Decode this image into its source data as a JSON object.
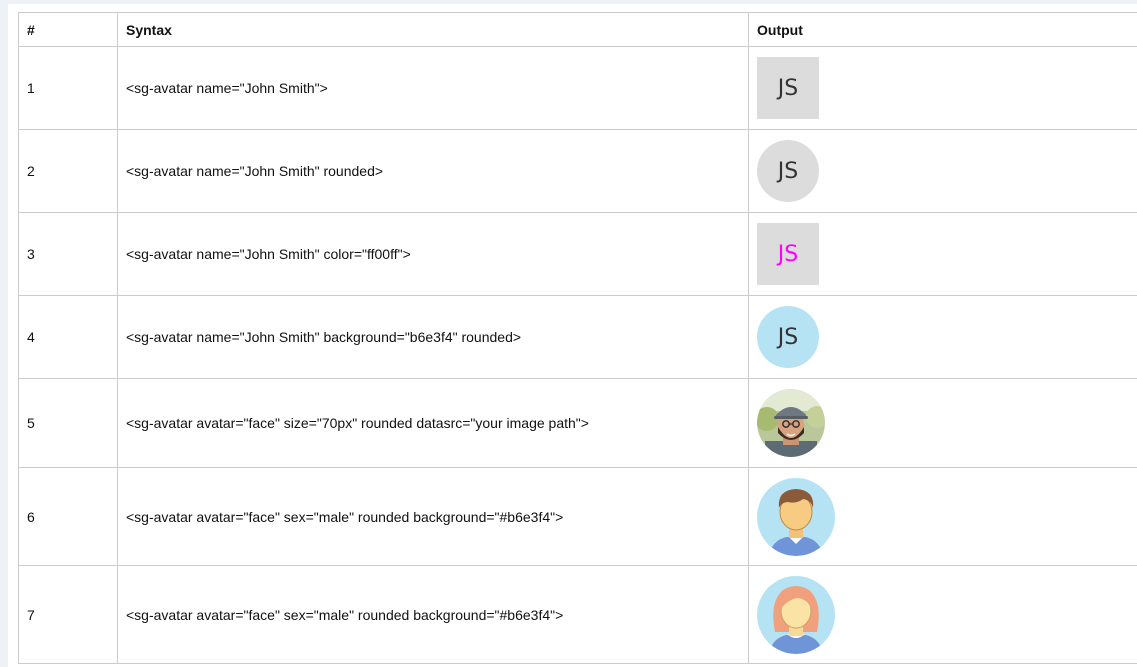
{
  "table": {
    "headers": {
      "num": "#",
      "syntax": "Syntax",
      "output": "Output"
    },
    "rows": [
      {
        "num": "1",
        "syntax": "<sg-avatar name=\"John Smith\">",
        "output": {
          "kind": "initials",
          "text": "JS",
          "shape": "square",
          "bg": "#dcdcdc",
          "color": "#333333"
        }
      },
      {
        "num": "2",
        "syntax": "<sg-avatar name=\"John Smith\" rounded>",
        "output": {
          "kind": "initials",
          "text": "JS",
          "shape": "round",
          "bg": "#dcdcdc",
          "color": "#333333"
        }
      },
      {
        "num": "3",
        "syntax": "<sg-avatar name=\"John Smith\" color=\"ff00ff\">",
        "output": {
          "kind": "initials",
          "text": "JS",
          "shape": "square",
          "bg": "#dcdcdc",
          "color": "#ff00ff"
        }
      },
      {
        "num": "4",
        "syntax": "<sg-avatar name=\"John Smith\" background=\"b6e3f4\" rounded>",
        "output": {
          "kind": "initials",
          "text": "JS",
          "shape": "round",
          "bg": "#b6e3f4",
          "color": "#333333"
        }
      },
      {
        "num": "5",
        "syntax": "<sg-avatar avatar=\"face\" size=\"70px\" rounded datasrc=\"your image path\">",
        "output": {
          "kind": "photo",
          "icon": "user-photo-icon",
          "shape": "round"
        }
      },
      {
        "num": "6",
        "syntax": "<sg-avatar avatar=\"face\" sex=\"male\" rounded background=\"#b6e3f4\">",
        "output": {
          "kind": "face",
          "icon": "male-face-icon",
          "shape": "round",
          "bg": "#b6e3f4"
        }
      },
      {
        "num": "7",
        "syntax": "<sg-avatar avatar=\"face\" sex=\"male\" rounded background=\"#b6e3f4\">",
        "output": {
          "kind": "face",
          "icon": "female-face-icon",
          "shape": "round",
          "bg": "#b6e3f4"
        }
      }
    ]
  }
}
